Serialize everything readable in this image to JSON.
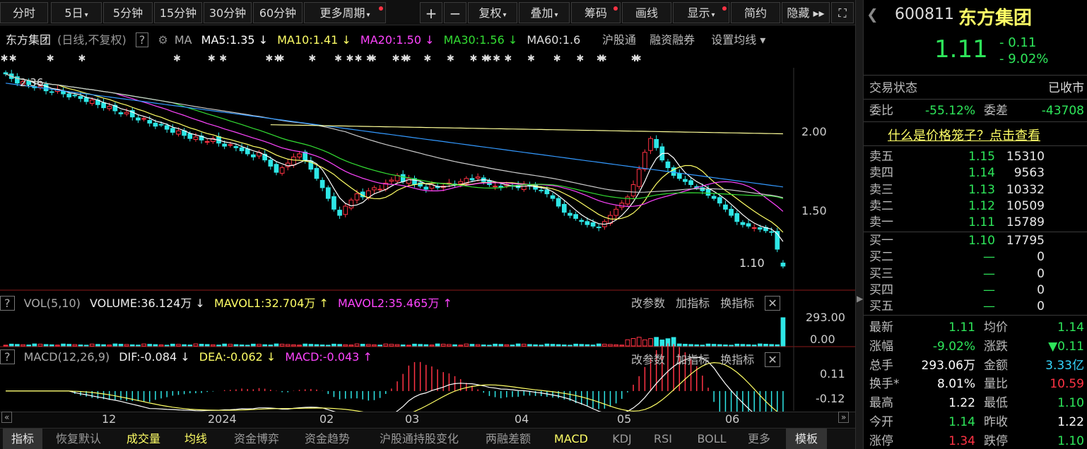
{
  "toolbar": {
    "periods": [
      "分时",
      "5日",
      "5分钟",
      "15分钟",
      "30分钟",
      "60分钟",
      "更多周期"
    ],
    "tools": [
      "+",
      "−",
      "复权",
      "叠加",
      "筹码",
      "画线",
      "显示",
      "简约",
      "隐藏 ▸▸"
    ],
    "fullscreen_icon": "fullscreen-icon"
  },
  "main_legend": {
    "name": "东方集团",
    "mode": "(日线,不复权)",
    "help": "?",
    "ma_label": "MA",
    "ma5": "MA5:1.35 ↓",
    "ma10": "MA10:1.41 ↓",
    "ma20": "MA20:1.50 ↓",
    "ma30": "MA30:1.56 ↓",
    "ma60": "MA60:1.6",
    "hgt": "沪股通",
    "rzrq": "融资融券",
    "set_ma": "设置均线 ▾"
  },
  "price_axis": {
    "high": "2.00",
    "mid": "1.50"
  },
  "price_labels": {
    "start_high": "2.36",
    "last_low": "1.10"
  },
  "vol_legend": {
    "name": "VOL(5,10)",
    "volume": "VOLUME:36.124万 ↓",
    "mavol1": "MAVOL1:32.704万 ↑",
    "mavol2": "MAVOL2:35.465万 ↑",
    "buttons": [
      "改参数",
      "加指标",
      "换指标"
    ],
    "axis_top": "293.00",
    "axis_bottom": "0.00"
  },
  "macd_legend": {
    "name": "MACD(12,26,9)",
    "dif": "DIF:-0.084 ↓",
    "dea": "DEA:-0.062 ↓",
    "macd": "MACD:-0.043 ↑",
    "buttons": [
      "改参数",
      "加指标",
      "换指标"
    ],
    "axis_top": "0.11",
    "axis_bottom": "-0.12"
  },
  "time_axis": [
    "12",
    "2024",
    "02",
    "03",
    "04",
    "05",
    "06"
  ],
  "tabs": [
    "指标",
    "恢复默认",
    "成交量",
    "均线",
    "资金博弈",
    "资金趋势",
    "沪股通持股变化",
    "两融差额",
    "MACD",
    "KDJ",
    "RSI",
    "BOLL",
    "更多",
    "模板"
  ],
  "quote": {
    "code": "600811",
    "name": "东方集团",
    "price": "1.11",
    "change": "- 0.11",
    "change_pct": "- 9.02%",
    "status_label": "交易状态",
    "status_value": "已收市",
    "weibi_label": "委比",
    "weibi_value": "-55.12%",
    "weicha_label": "委差",
    "weicha_value": "-43708",
    "cage_link": "什么是价格笼子？点击查看",
    "asks": [
      {
        "label": "卖五",
        "price": "1.15",
        "vol": "15310"
      },
      {
        "label": "卖四",
        "price": "1.14",
        "vol": "9563"
      },
      {
        "label": "卖三",
        "price": "1.13",
        "vol": "10332"
      },
      {
        "label": "卖二",
        "price": "1.12",
        "vol": "10509"
      },
      {
        "label": "卖一",
        "price": "1.11",
        "vol": "15789"
      }
    ],
    "bids": [
      {
        "label": "买一",
        "price": "1.10",
        "vol": "17795"
      },
      {
        "label": "买二",
        "price": "—",
        "vol": "0"
      },
      {
        "label": "买三",
        "price": "—",
        "vol": "0"
      },
      {
        "label": "买四",
        "price": "—",
        "vol": "0"
      },
      {
        "label": "买五",
        "price": "—",
        "vol": "0"
      }
    ],
    "stats": [
      {
        "l1": "最新",
        "v1": "1.11",
        "c1": "green",
        "l2": "均价",
        "v2": "1.14",
        "c2": "green"
      },
      {
        "l1": "涨幅",
        "v1": "-9.02%",
        "c1": "green",
        "l2": "涨跌",
        "v2": "▼0.11",
        "c2": "green"
      },
      {
        "l1": "总手",
        "v1": "293.06万",
        "c1": "white",
        "l2": "金额",
        "v2": "3.33亿",
        "c2": "cyan"
      },
      {
        "l1": "换手*",
        "v1": "8.01%",
        "c1": "white",
        "l2": "量比",
        "v2": "10.59",
        "c2": "red"
      },
      {
        "l1": "最高",
        "v1": "1.22",
        "c1": "white",
        "l2": "最低",
        "v2": "1.10",
        "c2": "green"
      },
      {
        "l1": "今开",
        "v1": "1.14",
        "c1": "green",
        "l2": "昨收",
        "v2": "1.22",
        "c2": "white"
      },
      {
        "l1": "涨停",
        "v1": "1.34",
        "c1": "red",
        "l2": "跌停",
        "v2": "1.10",
        "c2": "green"
      }
    ]
  },
  "colors": {
    "up": "#ff3344",
    "down": "#2ee6e6",
    "ma5": "#ffffff",
    "ma10": "#ffff66",
    "ma20": "#ff44ff",
    "ma30": "#33dd33",
    "ma60": "#cccccc",
    "ma120": "#3399ff",
    "ma250": "#ffff99"
  },
  "chart_data": {
    "type": "candlestick",
    "period": "daily",
    "ylim_price": [
      1.05,
      2.4
    ],
    "x_labels": [
      "12",
      "2024",
      "02",
      "03",
      "04",
      "05",
      "06"
    ],
    "close": [
      2.36,
      2.33,
      2.3,
      2.31,
      2.29,
      2.27,
      2.28,
      2.25,
      2.24,
      2.26,
      2.23,
      2.21,
      2.22,
      2.2,
      2.18,
      2.19,
      2.16,
      2.14,
      2.15,
      2.12,
      2.1,
      2.11,
      2.08,
      2.06,
      2.07,
      2.04,
      2.02,
      2.03,
      2.0,
      1.98,
      1.99,
      1.96,
      1.94,
      1.95,
      1.93,
      1.92,
      1.94,
      1.91,
      1.89,
      1.9,
      1.88,
      1.86,
      1.84,
      1.82,
      1.85,
      1.8,
      1.76,
      1.72,
      1.75,
      1.78,
      1.82,
      1.84,
      1.8,
      1.74,
      1.68,
      1.62,
      1.55,
      1.48,
      1.44,
      1.5,
      1.54,
      1.58,
      1.56,
      1.6,
      1.62,
      1.61,
      1.65,
      1.67,
      1.7,
      1.66,
      1.68,
      1.64,
      1.63,
      1.61,
      1.64,
      1.62,
      1.63,
      1.65,
      1.64,
      1.66,
      1.68,
      1.67,
      1.69,
      1.66,
      1.64,
      1.63,
      1.62,
      1.64,
      1.63,
      1.62,
      1.64,
      1.63,
      1.61,
      1.6,
      1.58,
      1.55,
      1.5,
      1.46,
      1.44,
      1.42,
      1.4,
      1.38,
      1.37,
      1.36,
      1.4,
      1.44,
      1.48,
      1.52,
      1.56,
      1.64,
      1.74,
      1.85,
      1.94,
      1.88,
      1.8,
      1.75,
      1.7,
      1.68,
      1.66,
      1.64,
      1.62,
      1.6,
      1.57,
      1.55,
      1.52,
      1.48,
      1.44,
      1.4,
      1.38,
      1.37,
      1.36,
      1.35,
      1.34,
      1.33,
      1.22,
      1.11
    ],
    "ma250_y": [
      2.06,
      1.97
    ],
    "volume_max": 293.0,
    "volume_last_wan": 36.124,
    "macd": {
      "dif": -0.084,
      "dea": -0.062,
      "macd": -0.043,
      "ylim": [
        -0.12,
        0.11
      ]
    }
  }
}
